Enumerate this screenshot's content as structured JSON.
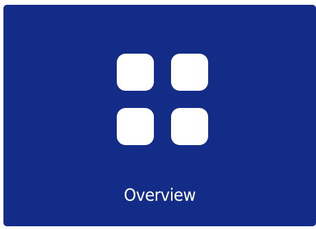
{
  "tile": {
    "label": "Overview",
    "icon": "grid-four-squares-icon",
    "background_color": "#132c87",
    "foreground_color": "#ffffff"
  }
}
